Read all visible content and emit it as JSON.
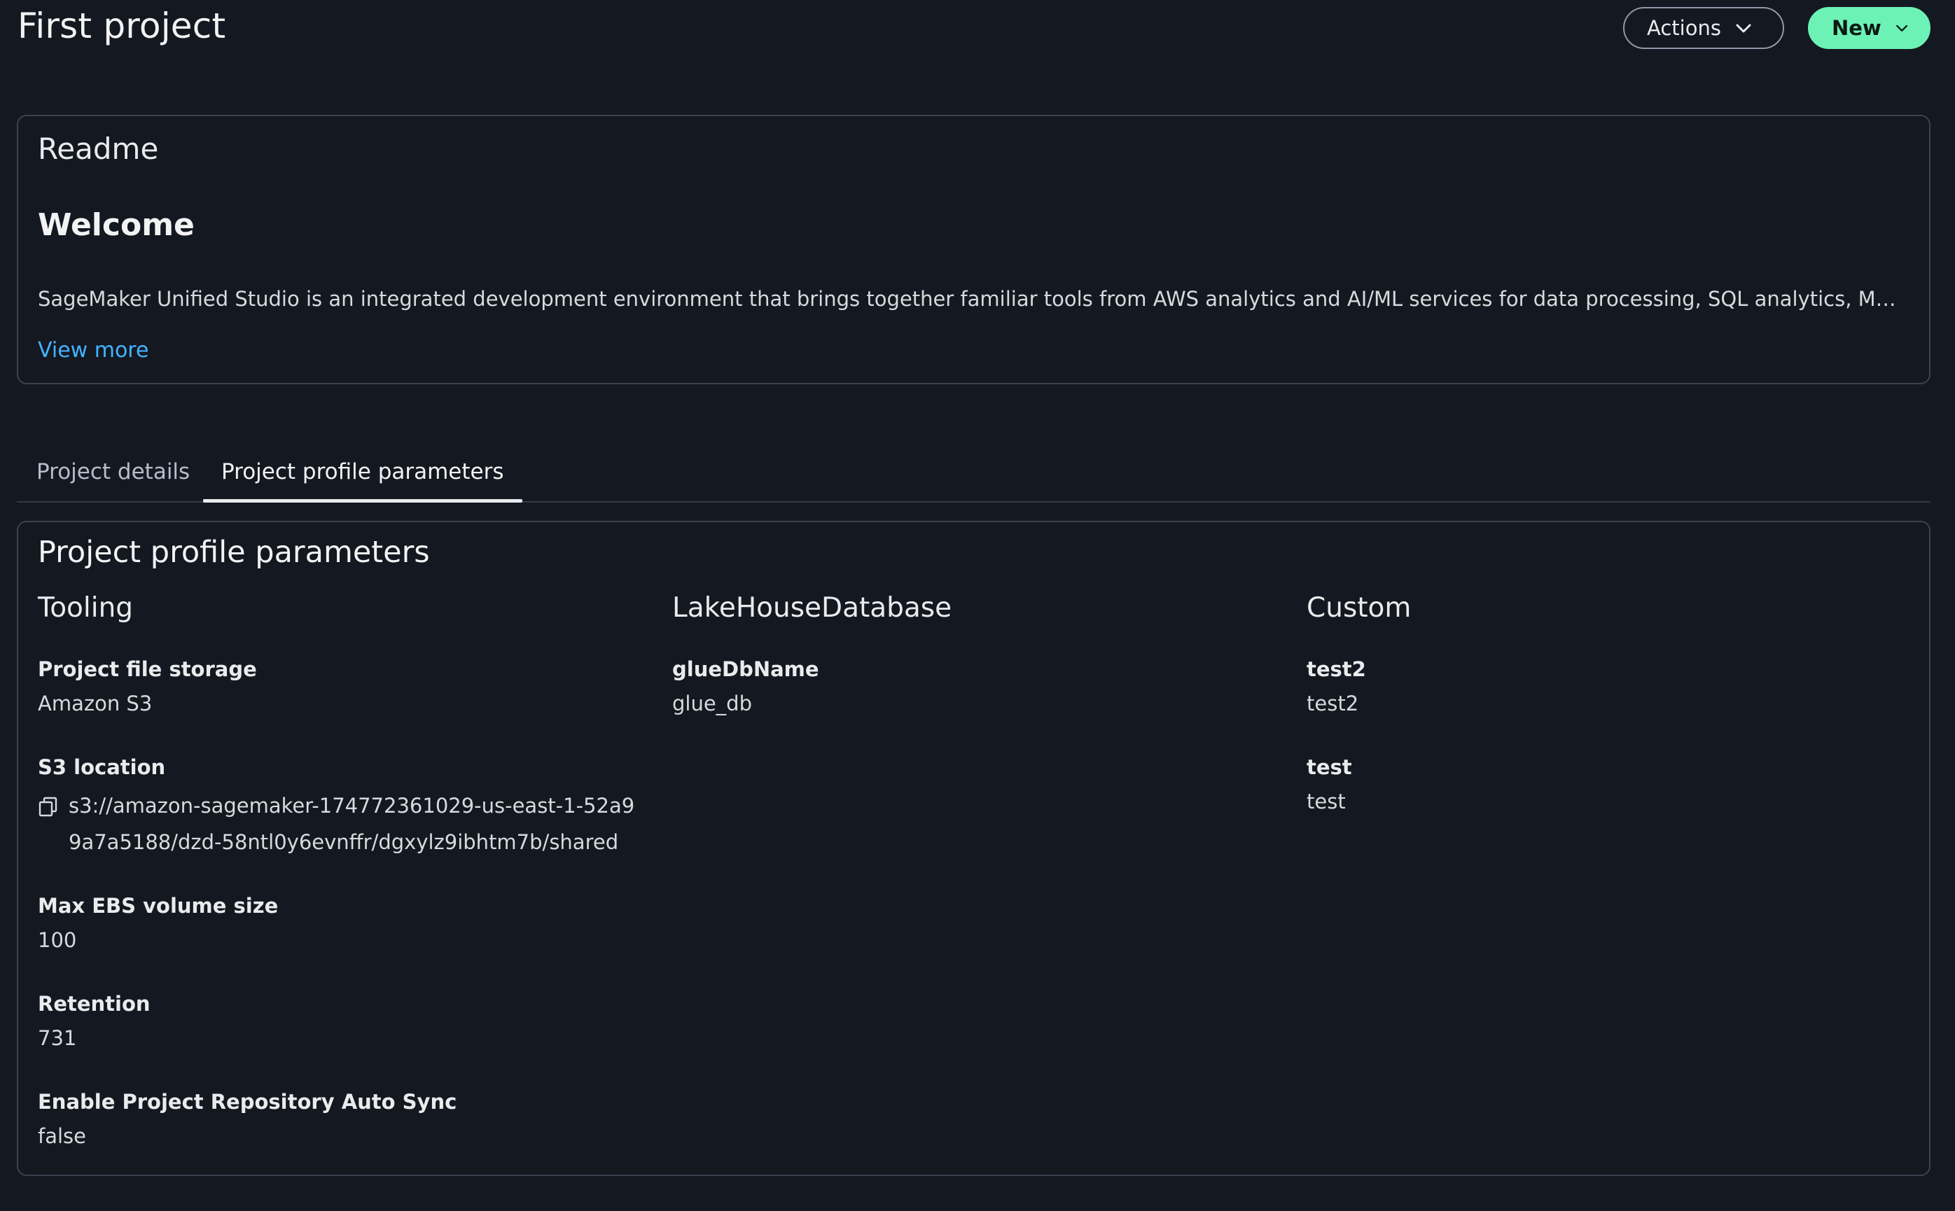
{
  "header": {
    "title": "First project",
    "actions_label": "Actions",
    "new_label": "New"
  },
  "readme": {
    "section_title": "Readme",
    "heading": "Welcome",
    "body": "SageMaker Unified Studio is an integrated development environment that brings together familiar tools from AWS analytics and AI/ML services for data processing, SQL analytics, ML...",
    "view_more": "View more"
  },
  "tabs": [
    {
      "label": "Project details",
      "active": false
    },
    {
      "label": "Project profile parameters",
      "active": true
    }
  ],
  "params": {
    "title": "Project profile parameters",
    "columns": [
      {
        "heading": "Tooling",
        "fields": [
          {
            "label": "Project file storage",
            "value": "Amazon S3"
          },
          {
            "label": "S3 location",
            "value": "s3://amazon-sagemaker-174772361029-us-east-1-52a99a7a5188/dzd-58ntl0y6evnffr/dgxylz9ibhtm7b/shared",
            "line1": "s3://amazon-sagemaker-174772361029-us-east-1-52a9",
            "line2": "9a7a5188/dzd-58ntl0y6evnffr/dgxylz9ibhtm7b/shared"
          },
          {
            "label": "Max EBS volume size",
            "value": "100"
          },
          {
            "label": "Retention",
            "value": "731"
          },
          {
            "label": "Enable Project Repository Auto Sync",
            "value": "false"
          }
        ]
      },
      {
        "heading": "LakeHouseDatabase",
        "fields": [
          {
            "label": "glueDbName",
            "value": "glue_db"
          }
        ]
      },
      {
        "heading": "Custom",
        "fields": [
          {
            "label": "test2",
            "value": "test2"
          },
          {
            "label": "test",
            "value": "test"
          }
        ]
      }
    ]
  },
  "icons": {
    "actions_chevron": "chevron-down-icon",
    "new_chevron": "chevron-down-icon",
    "copy": "copy-icon"
  },
  "colors": {
    "background": "#141821",
    "accent_primary": "#6df2b5",
    "link": "#42b4ff",
    "border": "#3a4350"
  }
}
